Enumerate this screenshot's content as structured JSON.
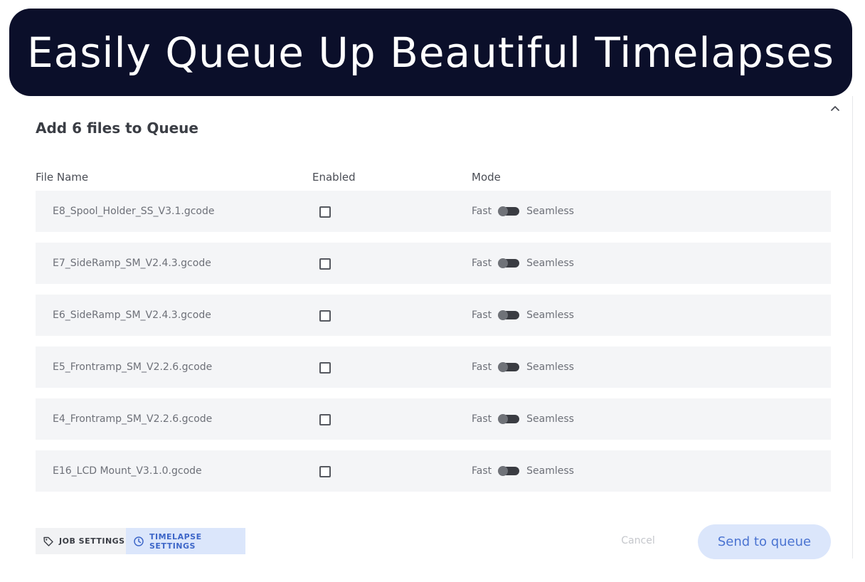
{
  "banner": {
    "text": "Easily Queue Up Beautiful Timelapses"
  },
  "dialog": {
    "title": "Add 6 files to Queue",
    "collapse_icon": "chevron-up-icon"
  },
  "table": {
    "headers": {
      "file_name": "File Name",
      "enabled": "Enabled",
      "mode": "Mode"
    },
    "rows": [
      {
        "file": "E8_Spool_Holder_SS_V3.1.gcode",
        "enabled": false,
        "mode_left": "Fast",
        "mode_right": "Seamless"
      },
      {
        "file": "E7_SideRamp_SM_V2.4.3.gcode",
        "enabled": false,
        "mode_left": "Fast",
        "mode_right": "Seamless"
      },
      {
        "file": "E6_SideRamp_SM_V2.4.3.gcode",
        "enabled": false,
        "mode_left": "Fast",
        "mode_right": "Seamless"
      },
      {
        "file": "E5_Frontramp_SM_V2.2.6.gcode",
        "enabled": false,
        "mode_left": "Fast",
        "mode_right": "Seamless"
      },
      {
        "file": "E4_Frontramp_SM_V2.2.6.gcode",
        "enabled": false,
        "mode_left": "Fast",
        "mode_right": "Seamless"
      },
      {
        "file": "E16_LCD Mount_V3.1.0.gcode",
        "enabled": false,
        "mode_left": "Fast",
        "mode_right": "Seamless"
      }
    ]
  },
  "tabs": {
    "job_settings": {
      "label": "JOB SETTINGS",
      "icon": "tag-icon"
    },
    "timelapse_settings": {
      "label": "TIMELAPSE SETTINGS",
      "icon": "clock-icon",
      "active": true
    }
  },
  "actions": {
    "cancel": "Cancel",
    "send": "Send to queue"
  },
  "colors": {
    "banner_bg": "#0b0f2a",
    "row_bg": "#f4f5f7",
    "accent": "#4a73d1",
    "accent_light": "#dbe6fb"
  }
}
